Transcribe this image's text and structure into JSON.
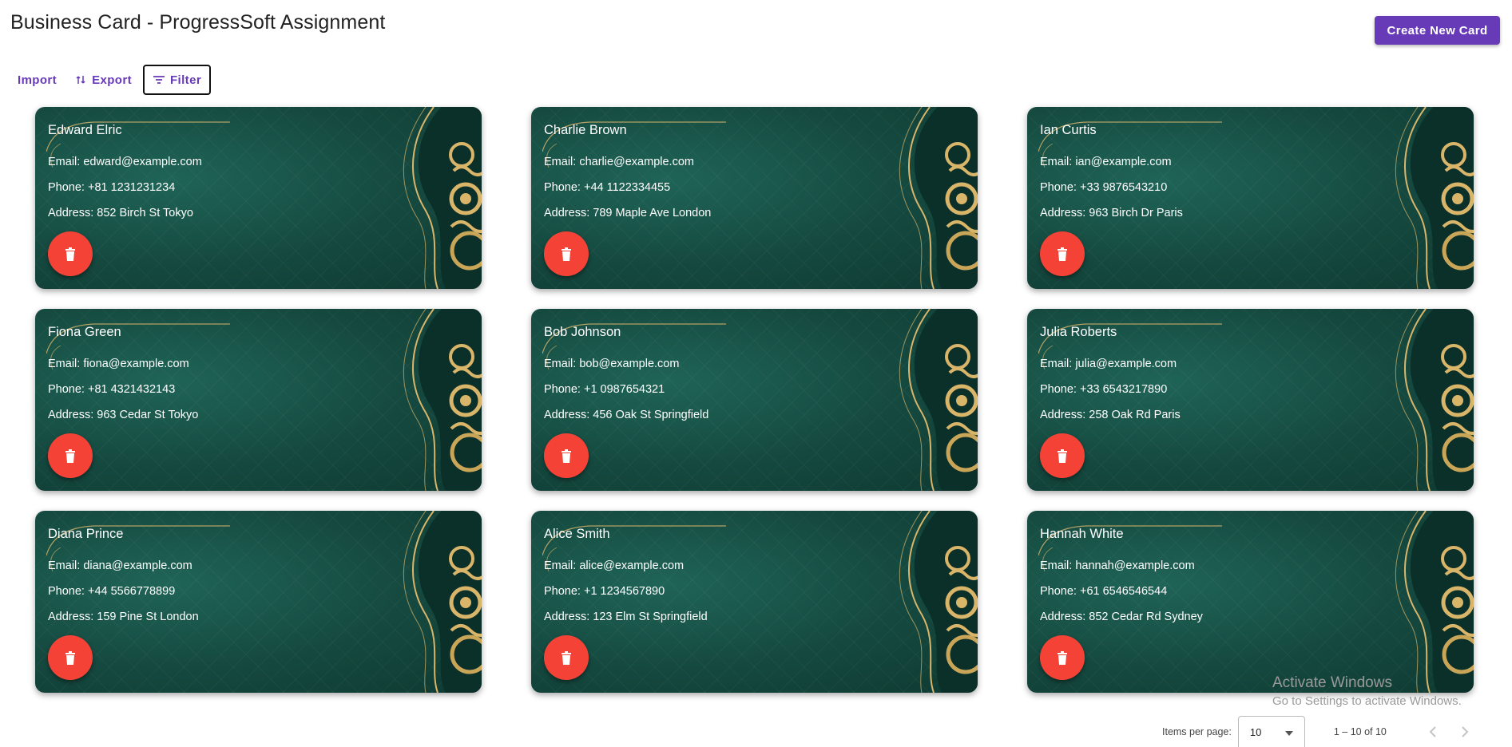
{
  "header": {
    "title": "Business Card - ProgressSoft Assignment",
    "create_label": "Create New Card"
  },
  "toolbar": {
    "import_label": "Import",
    "export_label": "Export",
    "filter_label": "Filter"
  },
  "cards": [
    {
      "name": "Edward Elric",
      "email": "Email: edward@example.com",
      "phone": "Phone: +81 1231231234",
      "address": "Address: 852 Birch St Tokyo"
    },
    {
      "name": "Charlie Brown",
      "email": "Email: charlie@example.com",
      "phone": "Phone: +44 1122334455",
      "address": "Address: 789 Maple Ave London"
    },
    {
      "name": "Ian Curtis",
      "email": "Email: ian@example.com",
      "phone": "Phone: +33 9876543210",
      "address": "Address: 963 Birch Dr Paris"
    },
    {
      "name": "Fiona Green",
      "email": "Email: fiona@example.com",
      "phone": "Phone: +81 4321432143",
      "address": "Address: 963 Cedar St Tokyo"
    },
    {
      "name": "Bob Johnson",
      "email": "Email: bob@example.com",
      "phone": "Phone: +1 0987654321",
      "address": "Address: 456 Oak St Springfield"
    },
    {
      "name": "Julia Roberts",
      "email": "Email: julia@example.com",
      "phone": "Phone: +33 6543217890",
      "address": "Address: 258 Oak Rd Paris"
    },
    {
      "name": "Diana Prince",
      "email": "Email: diana@example.com",
      "phone": "Phone: +44 5566778899",
      "address": "Address: 159 Pine St London"
    },
    {
      "name": "Alice Smith",
      "email": "Email: alice@example.com",
      "phone": "Phone: +1 1234567890",
      "address": "Address: 123 Elm St Springfield"
    },
    {
      "name": "Hannah White",
      "email": "Email: hannah@example.com",
      "phone": "Phone: +61 6546546544",
      "address": "Address: 852 Cedar Rd Sydney"
    }
  ],
  "paginator": {
    "items_per_page_label": "Items per page:",
    "items_per_page_value": "10",
    "range_label": "1 – 10 of 10"
  },
  "watermark": {
    "line1": "Activate Windows",
    "line2": "Go to Settings to activate Windows."
  },
  "colors": {
    "accent": "#673ab7",
    "delete": "#f44336",
    "card_bg": "#15493f",
    "gold": "#d9b56a"
  }
}
